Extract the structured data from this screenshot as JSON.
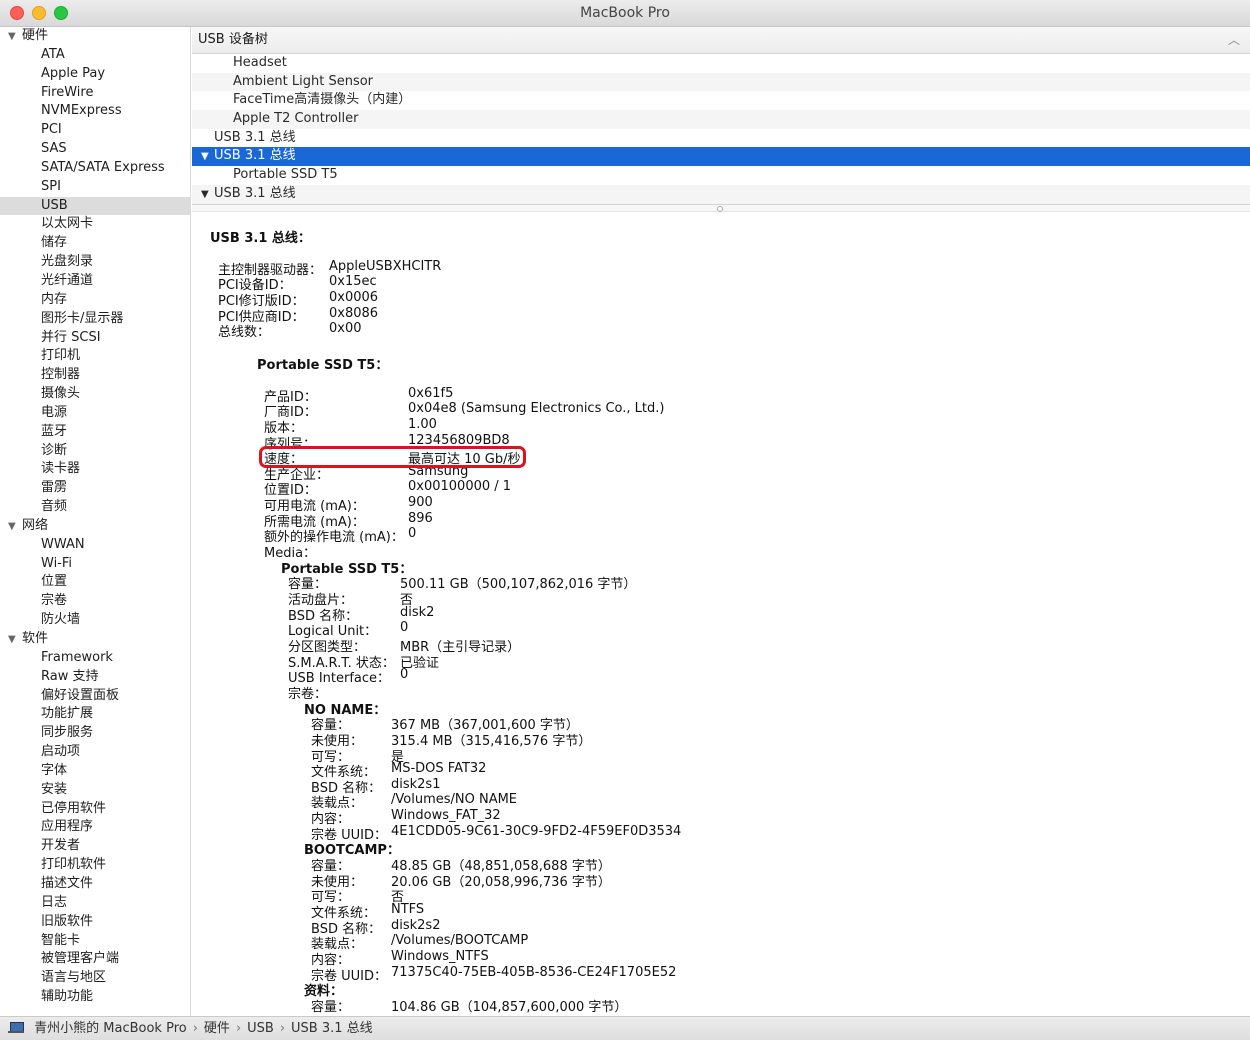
{
  "window": {
    "title": "MacBook Pro"
  },
  "sidebar": {
    "groups": [
      {
        "label": "硬件",
        "items": [
          "ATA",
          "Apple Pay",
          "FireWire",
          "NVMExpress",
          "PCI",
          "SAS",
          "SATA/SATA Express",
          "SPI",
          "USB",
          "以太网卡",
          "储存",
          "光盘刻录",
          "光纤通道",
          "内存",
          "图形卡/显示器",
          "并行 SCSI",
          "打印机",
          "控制器",
          "摄像头",
          "电源",
          "蓝牙",
          "诊断",
          "读卡器",
          "雷雳",
          "音频"
        ]
      },
      {
        "label": "网络",
        "items": [
          "WWAN",
          "Wi-Fi",
          "位置",
          "宗卷",
          "防火墙"
        ]
      },
      {
        "label": "软件",
        "items": [
          "Framework",
          "Raw 支持",
          "偏好设置面板",
          "功能扩展",
          "同步服务",
          "启动项",
          "字体",
          "安装",
          "已停用软件",
          "应用程序",
          "开发者",
          "打印机软件",
          "描述文件",
          "日志",
          "旧版软件",
          "智能卡",
          "被管理客户端",
          "语言与地区",
          "辅助功能"
        ]
      }
    ],
    "selected": "USB"
  },
  "tree": {
    "header": "USB 设备树",
    "rows": [
      {
        "label": "Headset",
        "indent": 2,
        "toggle": ""
      },
      {
        "label": "Ambient Light Sensor",
        "indent": 2,
        "toggle": ""
      },
      {
        "label": "FaceTime高清摄像头（内建）",
        "indent": 2,
        "toggle": ""
      },
      {
        "label": "Apple T2 Controller",
        "indent": 2,
        "toggle": ""
      },
      {
        "label": "USB 3.1 总线",
        "indent": 1,
        "toggle": ""
      },
      {
        "label": "USB 3.1 总线",
        "indent": 1,
        "toggle": "▼",
        "selected": true
      },
      {
        "label": "Portable SSD T5",
        "indent": 2,
        "toggle": ""
      },
      {
        "label": "USB 3.1 总线",
        "indent": 1,
        "toggle": "▼"
      }
    ]
  },
  "detail": {
    "rows": [
      {
        "type": "h",
        "text": "USB 3.1 总线：",
        "level": 0
      },
      {
        "type": "kv",
        "key": "主控制器驱动器：",
        "value": "AppleUSBXHCITR",
        "level": 0
      },
      {
        "type": "kv",
        "key": "PCI设备ID：",
        "value": "0x15ec",
        "level": 0
      },
      {
        "type": "kv",
        "key": "PCI修订版ID：",
        "value": "0x0006",
        "level": 0
      },
      {
        "type": "kv",
        "key": "PCI供应商ID：",
        "value": "0x8086",
        "level": 0
      },
      {
        "type": "kv",
        "key": "总线数：",
        "value": "0x00",
        "level": 0
      },
      {
        "type": "h",
        "text": "Portable SSD T5：",
        "level": 1
      },
      {
        "type": "kv",
        "key": "产品ID：",
        "value": "0x61f5",
        "level": 1
      },
      {
        "type": "kv",
        "key": "厂商ID：",
        "value": "0x04e8  (Samsung Electronics Co., Ltd.)",
        "level": 1
      },
      {
        "type": "kv",
        "key": "版本：",
        "value": "1.00",
        "level": 1
      },
      {
        "type": "kv",
        "key": "序列号：",
        "value": "123456809BD8",
        "level": 1
      },
      {
        "type": "kv",
        "key": "速度：",
        "value": "最高可达 10 Gb/秒",
        "level": 1
      },
      {
        "type": "kv",
        "key": "生产企业：",
        "value": "Samsung",
        "level": 1
      },
      {
        "type": "kv",
        "key": "位置ID：",
        "value": "0x00100000 / 1",
        "level": 1
      },
      {
        "type": "kv",
        "key": "可用电流 (mA)：",
        "value": "900",
        "level": 1
      },
      {
        "type": "kv",
        "key": "所需电流 (mA)：",
        "value": "896",
        "level": 1
      },
      {
        "type": "kv",
        "key": "额外的操作电流 (mA)：",
        "value": "0",
        "level": 1
      },
      {
        "type": "kv",
        "key": "Media：",
        "value": "",
        "level": 1
      },
      {
        "type": "h",
        "text": "Portable SSD T5：",
        "level": 2
      },
      {
        "type": "kv",
        "key": "容量：",
        "value": "500.11 GB（500,107,862,016 字节）",
        "level": 2
      },
      {
        "type": "kv",
        "key": "活动盘片：",
        "value": "否",
        "level": 2
      },
      {
        "type": "kv",
        "key": "BSD 名称：",
        "value": "disk2",
        "level": 2
      },
      {
        "type": "kv",
        "key": "Logical Unit：",
        "value": "0",
        "level": 2
      },
      {
        "type": "kv",
        "key": "分区图类型：",
        "value": "MBR（主引导记录）",
        "level": 2
      },
      {
        "type": "kv",
        "key": "S.M.A.R.T. 状态：",
        "value": "已验证",
        "level": 2
      },
      {
        "type": "kv",
        "key": "USB Interface：",
        "value": "0",
        "level": 2
      },
      {
        "type": "kv",
        "key": "宗卷：",
        "value": "",
        "level": 2
      },
      {
        "type": "h",
        "text": "NO NAME：",
        "level": 3
      },
      {
        "type": "kv",
        "key": "容量：",
        "value": "367 MB（367,001,600 字节）",
        "level": 3
      },
      {
        "type": "kv",
        "key": "未使用：",
        "value": "315.4 MB（315,416,576 字节）",
        "level": 3
      },
      {
        "type": "kv",
        "key": "可写：",
        "value": "是",
        "level": 3
      },
      {
        "type": "kv",
        "key": "文件系统：",
        "value": "MS-DOS FAT32",
        "level": 3
      },
      {
        "type": "kv",
        "key": "BSD 名称：",
        "value": "disk2s1",
        "level": 3
      },
      {
        "type": "kv",
        "key": "装载点：",
        "value": "/Volumes/NO NAME",
        "level": 3
      },
      {
        "type": "kv",
        "key": "内容：",
        "value": "Windows_FAT_32",
        "level": 3
      },
      {
        "type": "kv",
        "key": "宗卷 UUID：",
        "value": "4E1CDD05-9C61-30C9-9FD2-4F59EF0D3534",
        "level": 3
      },
      {
        "type": "h",
        "text": "BOOTCAMP：",
        "level": 3
      },
      {
        "type": "kv",
        "key": "容量：",
        "value": "48.85 GB（48,851,058,688 字节）",
        "level": 3
      },
      {
        "type": "kv",
        "key": "未使用：",
        "value": "20.06 GB（20,058,996,736 字节）",
        "level": 3
      },
      {
        "type": "kv",
        "key": "可写：",
        "value": "否",
        "level": 3
      },
      {
        "type": "kv",
        "key": "文件系统：",
        "value": "NTFS",
        "level": 3
      },
      {
        "type": "kv",
        "key": "BSD 名称：",
        "value": "disk2s2",
        "level": 3
      },
      {
        "type": "kv",
        "key": "装载点：",
        "value": "/Volumes/BOOTCAMP",
        "level": 3
      },
      {
        "type": "kv",
        "key": "内容：",
        "value": "Windows_NTFS",
        "level": 3
      },
      {
        "type": "kv",
        "key": "宗卷 UUID：",
        "value": "71375C40-75EB-405B-8536-CE24F1705E52",
        "level": 3
      },
      {
        "type": "h",
        "text": "资料：",
        "level": 3
      },
      {
        "type": "kv",
        "key": "容量：",
        "value": "104.86 GB（104,857,600,000 字节）",
        "level": 3
      }
    ]
  },
  "statusbar": {
    "path": [
      "青州小熊的 MacBook Pro",
      "硬件",
      "USB",
      "USB 3.1 总线"
    ]
  },
  "colors": {
    "selection": "#1a67d6",
    "highlight_box": "#e0111f"
  }
}
